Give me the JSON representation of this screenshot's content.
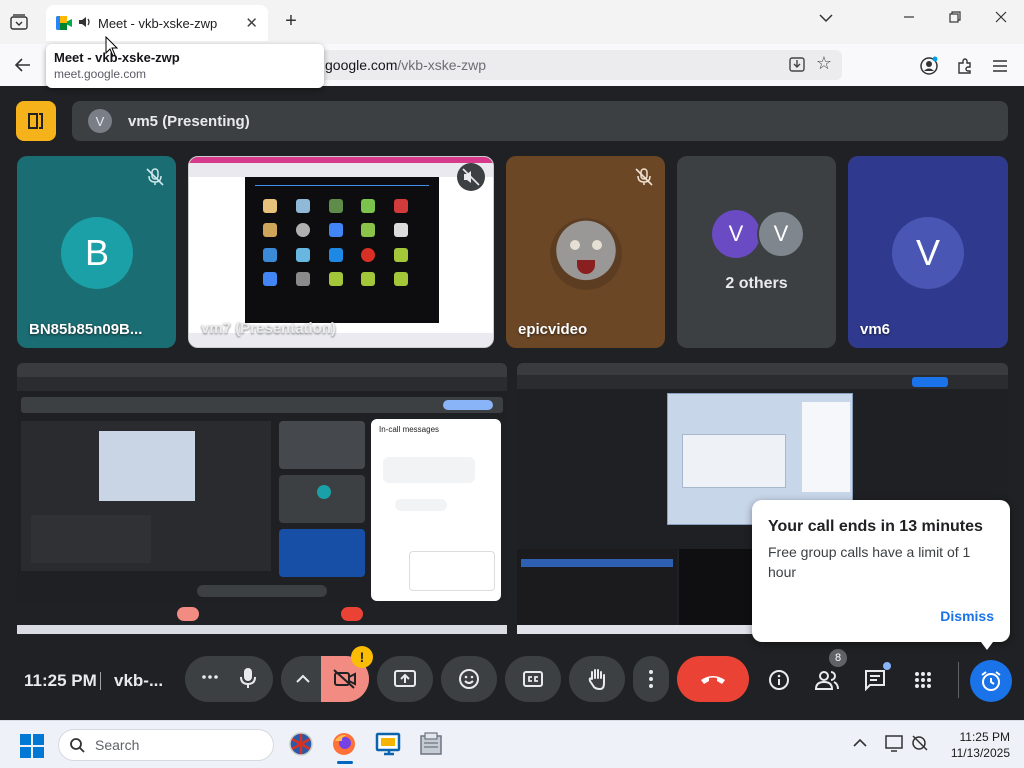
{
  "browser": {
    "tab_title": "Meet - vkb-xske-zwp",
    "url_host": "meet.google.com",
    "url_path": "/vkb-xske-zwp",
    "url_prefix_hidden": "meet.",
    "url_visible": "google.com",
    "tooltip_title": "Meet - vkb-xske-zwp",
    "tooltip_url": "meet.google.com"
  },
  "meet": {
    "presenting_avatar": "V",
    "presenting_label": "vm5 (Presenting)",
    "tiles": [
      {
        "name": "BN85b85n09B...",
        "avatar": "B",
        "muted": true
      },
      {
        "name": "vm7 (Presentation)",
        "muted": true
      },
      {
        "name": "epicvideo",
        "muted": true
      },
      {
        "label": "2 others",
        "avatars": [
          "V",
          "V"
        ]
      },
      {
        "name": "vm6",
        "avatar": "V"
      }
    ],
    "screen_share_text": "Your call ends in 13 minutes",
    "chat_title": "In-call messages",
    "toast": {
      "title": "Your call ends in 13 minutes",
      "body": "Free group calls have a limit of 1 hour",
      "dismiss": "Dismiss"
    },
    "controls": {
      "clock": "11:25 PM",
      "code": "vkb-...",
      "people_count": "8"
    }
  },
  "taskbar": {
    "search_label": "Search",
    "time": "11:25 PM",
    "date": "11/13/2025"
  },
  "colors": {
    "background": "#202124",
    "tile_dark": "#3c4043",
    "end_call": "#ea4335",
    "accent_blue": "#1a73e8",
    "pin_yellow": "#f6b21b",
    "camera_off_pink": "#f28b82"
  }
}
